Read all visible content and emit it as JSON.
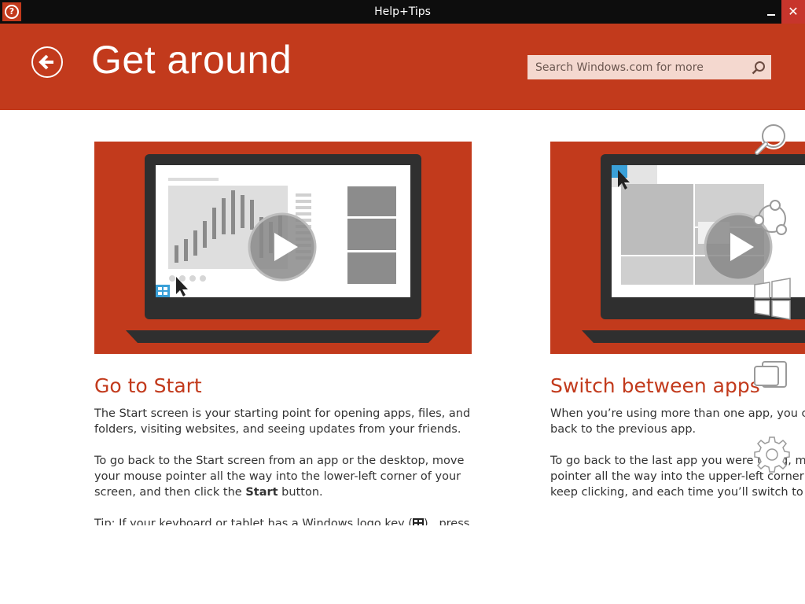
{
  "window": {
    "title": "Help+Tips",
    "close_glyph": "✕"
  },
  "header": {
    "title": "Get around",
    "search_placeholder": "Search Windows.com for more",
    "accent": "#c23a1c"
  },
  "cards": [
    {
      "title": "Go to Start",
      "paragraphs": [
        "The Start screen is your starting point for opening apps, files, and folders, visiting websites, and seeing updates from your friends.",
        "Tip: If your keyboard or tablet has a Windows logo key (",
        ") , press it to"
      ],
      "p2_before": "To go back to the Start screen from an app or the desktop, move your mouse pointer all the way into the lower-left corner of your screen, and then click the ",
      "p2_bold": "Start",
      "p2_after": " button."
    },
    {
      "title": "Switch between apps",
      "paragraphs": [
        "When you’re using more than one app, you can quickly switch back to the previous app.",
        "To go back to the last app you were using, move your mouse pointer all the way into the upper-left corner of your screen, and keep clicking, and each time you’ll switch to the previous app."
      ]
    }
  ],
  "charms": [
    "search-charm",
    "share-charm",
    "start-charm",
    "devices-charm",
    "settings-charm"
  ]
}
